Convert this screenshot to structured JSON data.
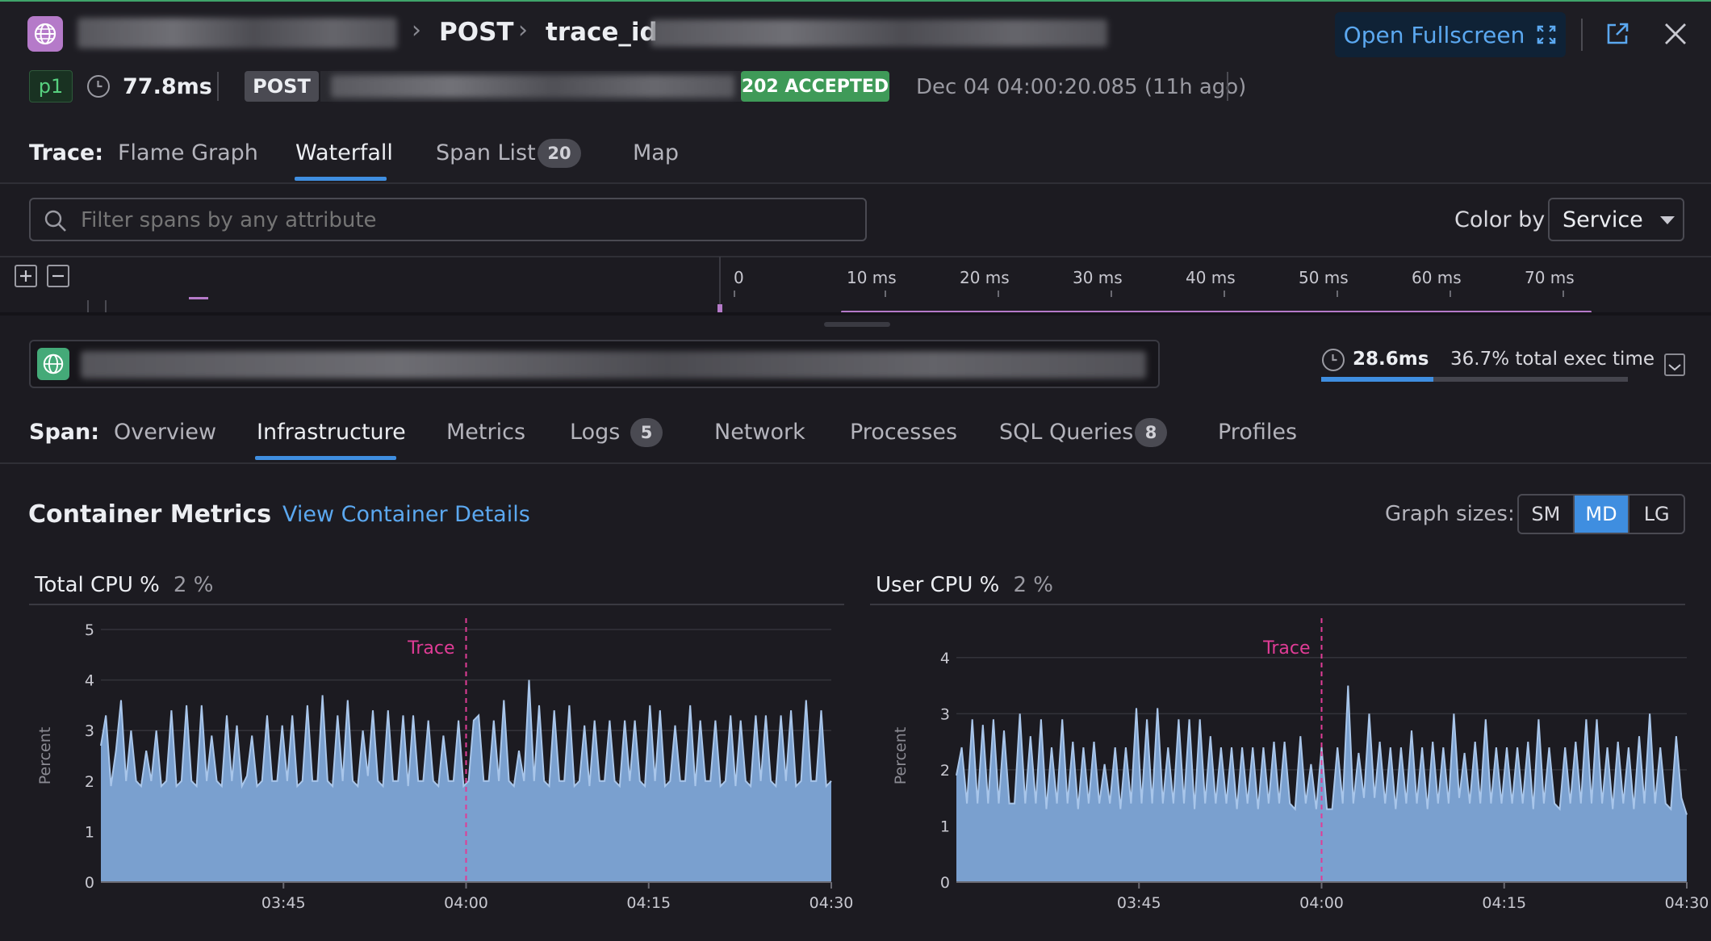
{
  "header": {
    "breadcrumb_method": "POST",
    "breadcrumb_trace": "trace_id",
    "open_fullscreen_label": "Open Fullscreen"
  },
  "meta": {
    "priority": "p1",
    "duration": "77.8ms",
    "method": "POST",
    "status": "202 ACCEPTED",
    "timestamp": "Dec 04 04:00:20.085 (11h ago)"
  },
  "trace_tabs": {
    "label": "Trace:",
    "items": [
      {
        "label": "Flame Graph"
      },
      {
        "label": "Waterfall"
      },
      {
        "label": "Span List",
        "count": "20"
      },
      {
        "label": "Map"
      }
    ],
    "active": "Waterfall"
  },
  "filter": {
    "placeholder": "Filter spans by any attribute",
    "color_by_label": "Color by",
    "color_by_value": "Service"
  },
  "timeline": {
    "ticks": [
      "0",
      "10 ms",
      "20 ms",
      "30 ms",
      "40 ms",
      "50 ms",
      "60 ms",
      "70 ms"
    ]
  },
  "span": {
    "duration": "28.6ms",
    "exec_time": "36.7% total exec time",
    "exec_fraction": 0.367
  },
  "span_tabs": {
    "label": "Span:",
    "items": [
      {
        "label": "Overview"
      },
      {
        "label": "Infrastructure"
      },
      {
        "label": "Metrics"
      },
      {
        "label": "Logs",
        "count": "5"
      },
      {
        "label": "Network"
      },
      {
        "label": "Processes"
      },
      {
        "label": "SQL Queries",
        "count": "8"
      },
      {
        "label": "Profiles"
      }
    ],
    "active": "Infrastructure"
  },
  "container": {
    "title": "Container Metrics",
    "details_link": "View Container Details",
    "graph_sizes_label": "Graph sizes:",
    "sizes": [
      "SM",
      "MD",
      "LG"
    ],
    "active_size": "MD"
  },
  "colors": {
    "accent": "#3f8ee0",
    "area_fill": "#7aa0cf",
    "area_line": "#a9c6ea",
    "trace_marker": "#e03c96",
    "status_ok": "#3f9a58",
    "priority": "#57d07f"
  },
  "chart_data": [
    {
      "type": "area",
      "title": "Total CPU %",
      "subtitle": "2 %",
      "ylabel": "Percent",
      "ylim": [
        0,
        5
      ],
      "yticks": [
        "0",
        "1",
        "2",
        "3",
        "4",
        "5"
      ],
      "xticks": [
        "03:45",
        "04:00",
        "04:15",
        "04:30"
      ],
      "marker": {
        "label": "Trace",
        "x": "04:00"
      },
      "x_start": "03:30",
      "x_end": "04:30",
      "values": [
        2.7,
        3.3,
        1.9,
        2.6,
        3.6,
        2.0,
        3.0,
        2.0,
        1.9,
        2.6,
        2.0,
        3.0,
        1.9,
        2.0,
        3.4,
        1.9,
        2.0,
        3.5,
        2.0,
        1.9,
        3.5,
        2.0,
        2.9,
        2.0,
        1.9,
        3.3,
        2.0,
        3.1,
        1.9,
        2.1,
        2.9,
        1.9,
        2.0,
        3.3,
        2.0,
        2.0,
        3.1,
        2.0,
        3.3,
        1.9,
        2.0,
        3.5,
        2.0,
        2.0,
        3.7,
        2.0,
        1.9,
        3.3,
        2.0,
        3.6,
        2.0,
        1.9,
        3.0,
        2.1,
        3.4,
        2.0,
        1.9,
        3.4,
        2.0,
        2.0,
        3.3,
        1.9,
        3.3,
        2.0,
        2.0,
        3.2,
        2.0,
        1.9,
        2.9,
        2.0,
        2.0,
        3.2,
        1.9,
        2.0,
        3.2,
        3.3,
        2.0,
        2.0,
        3.2,
        2.0,
        3.6,
        2.0,
        1.9,
        2.6,
        2.0,
        4.0,
        2.0,
        3.5,
        2.0,
        1.9,
        3.4,
        2.0,
        2.0,
        3.5,
        1.9,
        2.0,
        3.1,
        1.9,
        3.2,
        2.0,
        2.0,
        3.2,
        2.0,
        1.9,
        3.2,
        2.0,
        3.2,
        2.0,
        1.9,
        3.5,
        2.0,
        3.4,
        1.9,
        2.0,
        3.1,
        2.0,
        2.0,
        3.5,
        1.9,
        3.2,
        2.0,
        2.0,
        3.2,
        1.9,
        2.0,
        3.3,
        1.9,
        3.2,
        2.0,
        1.9,
        3.3,
        2.0,
        3.3,
        2.0,
        1.9,
        3.3,
        2.0,
        3.4,
        1.9,
        2.0,
        3.6,
        2.0,
        2.0,
        3.4,
        1.9,
        2.0
      ]
    },
    {
      "type": "area",
      "title": "User CPU %",
      "subtitle": "2 %",
      "ylabel": "Percent",
      "ylim": [
        0,
        4.5
      ],
      "yticks": [
        "0",
        "1",
        "2",
        "3",
        "4"
      ],
      "xticks": [
        "03:45",
        "04:00",
        "04:15",
        "04:30"
      ],
      "marker": {
        "label": "Trace",
        "x": "04:00"
      },
      "x_start": "03:30",
      "x_end": "04:30",
      "values": [
        1.9,
        2.4,
        1.4,
        2.9,
        1.4,
        2.8,
        1.4,
        2.9,
        1.4,
        2.7,
        1.4,
        1.4,
        3.0,
        1.4,
        2.6,
        1.4,
        2.9,
        1.3,
        2.4,
        1.4,
        2.9,
        1.4,
        2.5,
        1.3,
        2.4,
        1.4,
        2.5,
        1.4,
        2.1,
        1.4,
        2.4,
        1.3,
        2.4,
        1.4,
        3.1,
        1.4,
        2.9,
        1.4,
        3.1,
        1.4,
        2.4,
        1.4,
        2.9,
        1.4,
        2.9,
        1.3,
        2.9,
        1.4,
        2.6,
        1.4,
        2.4,
        1.4,
        2.4,
        1.3,
        2.4,
        1.4,
        2.4,
        1.3,
        2.4,
        1.4,
        2.5,
        1.4,
        2.5,
        1.4,
        1.3,
        2.6,
        1.4,
        2.1,
        1.3,
        2.4,
        1.3,
        1.3,
        2.4,
        1.4,
        3.5,
        1.4,
        2.3,
        1.5,
        3.0,
        1.5,
        2.5,
        1.4,
        2.4,
        1.3,
        2.4,
        1.4,
        2.7,
        1.4,
        2.4,
        1.3,
        2.5,
        1.4,
        2.4,
        1.4,
        3.0,
        1.5,
        2.3,
        1.4,
        2.5,
        1.4,
        2.9,
        1.4,
        2.4,
        1.4,
        2.4,
        1.4,
        2.4,
        1.4,
        2.5,
        1.3,
        2.9,
        1.4,
        2.4,
        1.4,
        1.3,
        2.4,
        1.4,
        2.5,
        1.4,
        2.9,
        1.4,
        2.9,
        1.4,
        2.4,
        1.3,
        2.5,
        1.4,
        2.4,
        1.3,
        2.6,
        1.4,
        3.0,
        1.4,
        2.4,
        1.4,
        1.3,
        2.6,
        1.5,
        1.2
      ]
    }
  ]
}
